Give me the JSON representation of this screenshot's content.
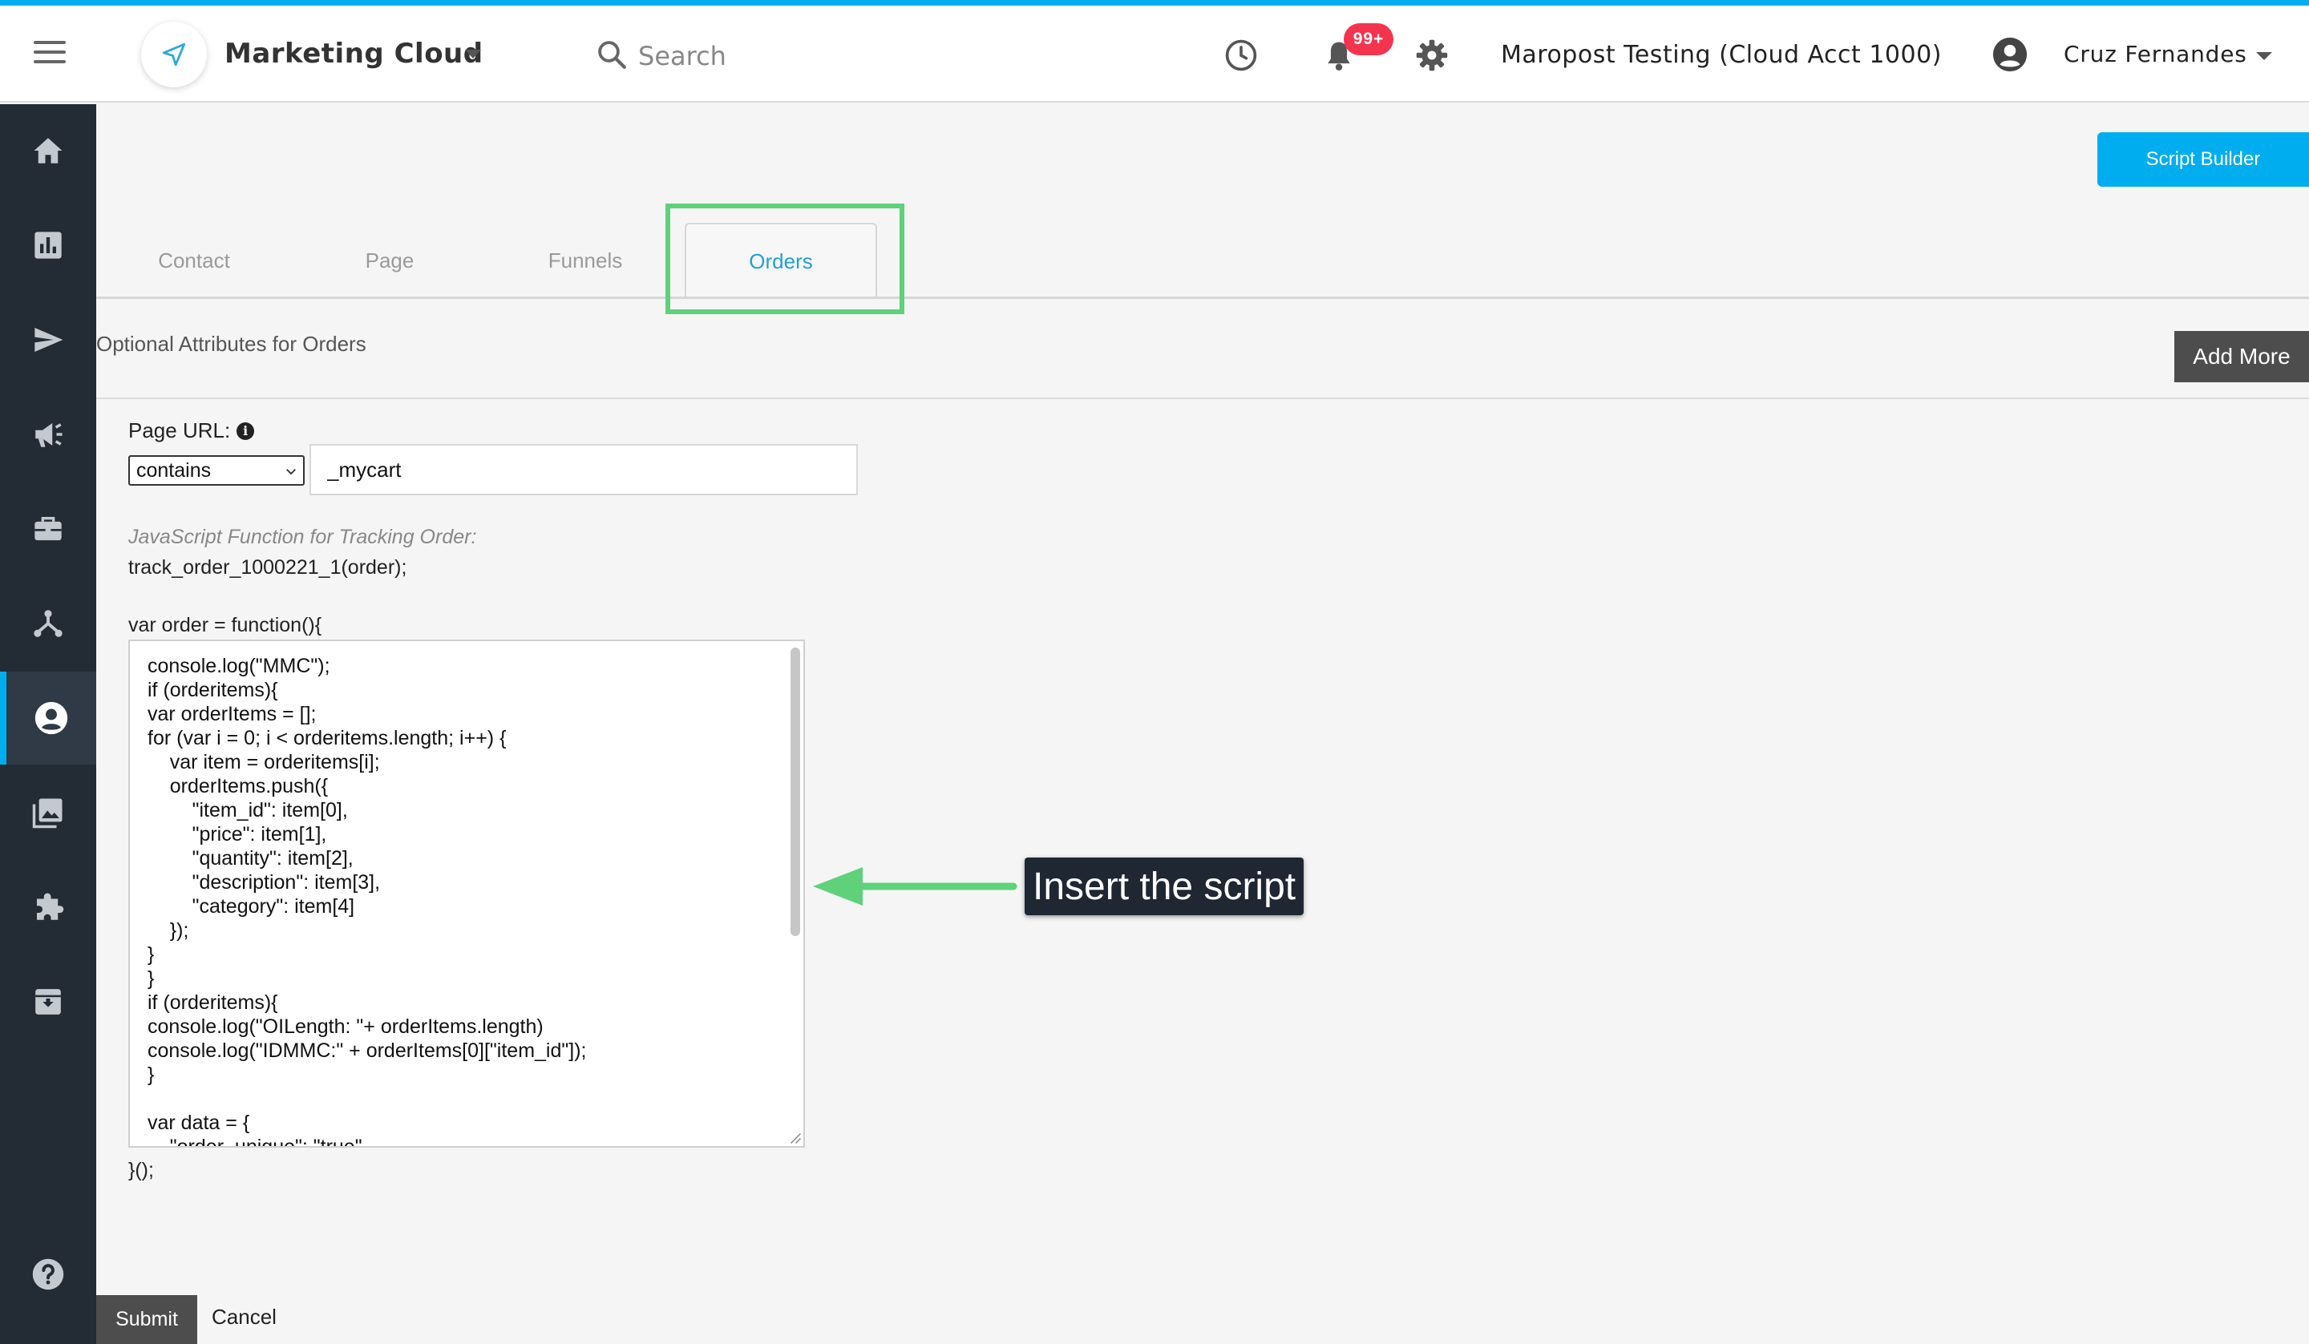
{
  "header": {
    "app_title": "Marketing Cloud",
    "search_placeholder": "Search",
    "notification_badge": "99+",
    "account_name": "Maropost Testing (Cloud Acct 1000)",
    "user_name": "Cruz Fernandes"
  },
  "sidebar": {
    "items": [
      "home-icon",
      "chart-icon",
      "send-icon",
      "megaphone-icon",
      "briefcase-icon",
      "network-icon",
      "user-icon",
      "gallery-icon",
      "puzzle-icon",
      "archive-icon",
      "help-icon"
    ],
    "active": "user-icon"
  },
  "toolbar": {
    "script_builder_label": "Script Builder"
  },
  "tabs": [
    {
      "label": "Contact",
      "active": false
    },
    {
      "label": "Page",
      "active": false
    },
    {
      "label": "Funnels",
      "active": false
    },
    {
      "label": "Orders",
      "active": true
    }
  ],
  "orders": {
    "optional_label": "Optional Attributes for Orders",
    "add_more_label": "Add More",
    "page_url_label": "Page URL:",
    "match_type": "contains",
    "url_value": "_mycart",
    "js_label": "JavaScript Function for Tracking Order:",
    "js_call": "track_order_1000221_1(order);",
    "fn_open": "var order = function(){",
    "code": "console.log(\"MMC\");\nif (orderitems){\nvar orderItems = [];\nfor (var i = 0; i < orderitems.length; i++) {\n    var item = orderitems[i];\n    orderItems.push({\n        \"item_id\": item[0],\n        \"price\": item[1],\n        \"quantity\": item[2],\n        \"description\": item[3],\n        \"category\": item[4]\n    });\n}\n}\nif (orderitems){\nconsole.log(\"OILength: \"+ orderItems.length)\nconsole.log(\"IDMMC:\" + orderItems[0][\"item_id\"]);\n}\n\nvar data = {\n    \"order_unique\": \"true\"",
    "fn_close": "}();"
  },
  "annotation": {
    "callout_text": "Insert the script",
    "highlight_color": "#5fd17a"
  },
  "footer": {
    "submit_label": "Submit",
    "cancel_label": "Cancel"
  },
  "colors": {
    "accent": "#00aeef",
    "sidebar_bg": "#232b35",
    "badge": "#f4344f"
  }
}
